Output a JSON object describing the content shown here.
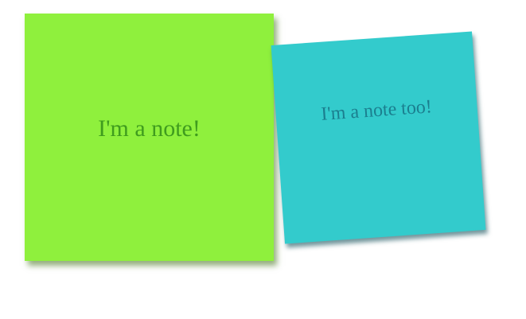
{
  "notes": [
    {
      "text": "I'm a note!",
      "color": "#8ff03d",
      "text_color": "#3f9c1e"
    },
    {
      "text": "I'm a note too!",
      "color": "#33cbcc",
      "text_color": "#1b7f8f"
    }
  ]
}
